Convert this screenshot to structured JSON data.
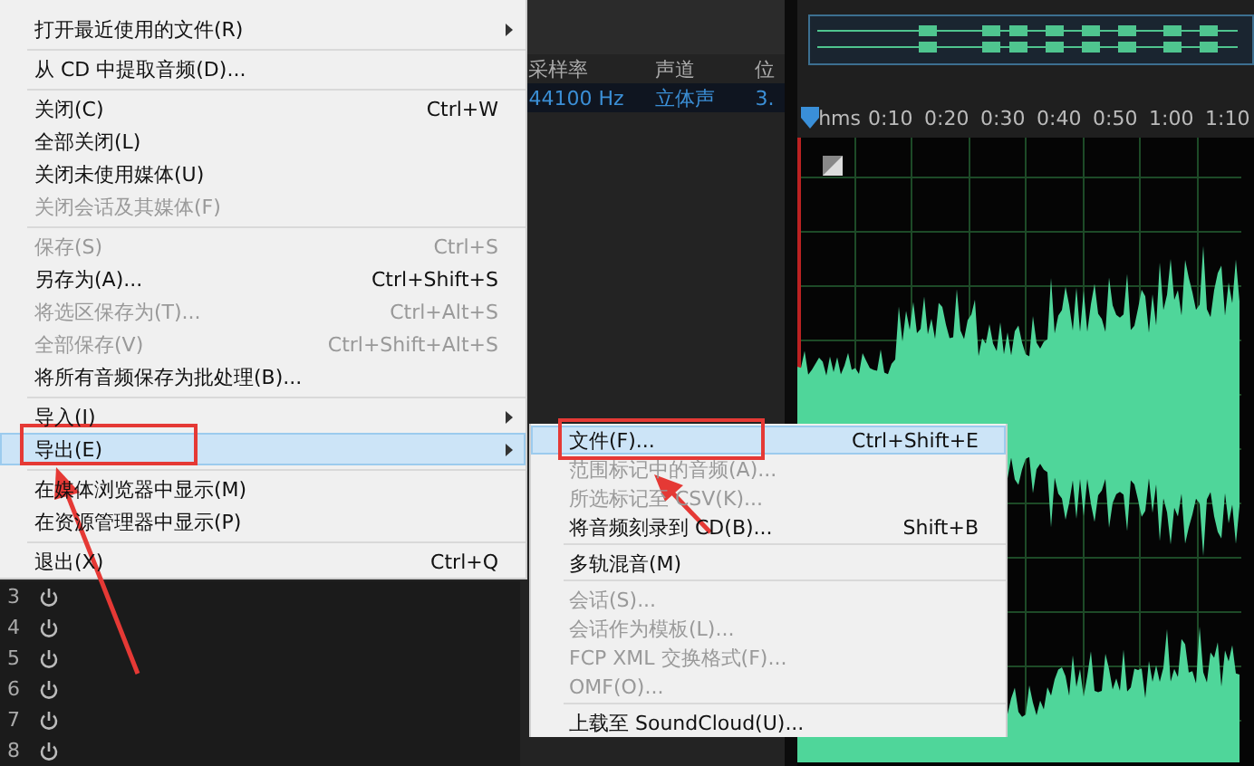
{
  "file_menu": {
    "items": [
      {
        "kind": "item",
        "label": "打开最近使用的文件(R)",
        "submenu": true,
        "disabled": false,
        "selected": false
      },
      {
        "kind": "separator"
      },
      {
        "kind": "item",
        "label": "从 CD 中提取音频(D)...",
        "submenu": false,
        "disabled": false,
        "selected": false
      },
      {
        "kind": "separator"
      },
      {
        "kind": "item",
        "label": "关闭(C)",
        "shortcut": "Ctrl+W",
        "submenu": false,
        "disabled": false,
        "selected": false
      },
      {
        "kind": "item",
        "label": "全部关闭(L)",
        "submenu": false,
        "disabled": false,
        "selected": false
      },
      {
        "kind": "item",
        "label": "关闭未使用媒体(U)",
        "submenu": false,
        "disabled": false,
        "selected": false
      },
      {
        "kind": "item",
        "label": "关闭会话及其媒体(F)",
        "submenu": false,
        "disabled": true,
        "selected": false
      },
      {
        "kind": "separator"
      },
      {
        "kind": "item",
        "label": "保存(S)",
        "shortcut": "Ctrl+S",
        "submenu": false,
        "disabled": true,
        "selected": false
      },
      {
        "kind": "item",
        "label": "另存为(A)...",
        "shortcut": "Ctrl+Shift+S",
        "submenu": false,
        "disabled": false,
        "selected": false
      },
      {
        "kind": "item",
        "label": "将选区保存为(T)...",
        "shortcut": "Ctrl+Alt+S",
        "submenu": false,
        "disabled": true,
        "selected": false
      },
      {
        "kind": "item",
        "label": "全部保存(V)",
        "shortcut": "Ctrl+Shift+Alt+S",
        "submenu": false,
        "disabled": true,
        "selected": false
      },
      {
        "kind": "item",
        "label": "将所有音频保存为批处理(B)...",
        "submenu": false,
        "disabled": false,
        "selected": false
      },
      {
        "kind": "separator"
      },
      {
        "kind": "item",
        "label": "导入(I)",
        "submenu": true,
        "disabled": false,
        "selected": false
      },
      {
        "kind": "item",
        "label": "导出(E)",
        "submenu": true,
        "disabled": false,
        "selected": true
      },
      {
        "kind": "separator"
      },
      {
        "kind": "item",
        "label": "在媒体浏览器中显示(M)",
        "submenu": false,
        "disabled": false,
        "selected": false
      },
      {
        "kind": "item",
        "label": "在资源管理器中显示(P)",
        "submenu": false,
        "disabled": false,
        "selected": false
      },
      {
        "kind": "separator"
      },
      {
        "kind": "item",
        "label": "退出(X)",
        "shortcut": "Ctrl+Q",
        "submenu": false,
        "disabled": false,
        "selected": false
      }
    ]
  },
  "export_submenu": {
    "items": [
      {
        "kind": "item",
        "label": "文件(F)...",
        "shortcut": "Ctrl+Shift+E",
        "disabled": false,
        "selected": true
      },
      {
        "kind": "item",
        "label": "范围标记中的音频(A)...",
        "disabled": true,
        "selected": false
      },
      {
        "kind": "item",
        "label": "所选标记至 CSV(K)...",
        "disabled": true,
        "selected": false
      },
      {
        "kind": "item",
        "label": "将音频刻录到 CD(B)...",
        "shortcut": "Shift+B",
        "disabled": false,
        "selected": false
      },
      {
        "kind": "separator"
      },
      {
        "kind": "item",
        "label": "多轨混音(M)",
        "disabled": false,
        "selected": false
      },
      {
        "kind": "separator"
      },
      {
        "kind": "item",
        "label": "会话(S)...",
        "disabled": true,
        "selected": false
      },
      {
        "kind": "item",
        "label": "会话作为模板(L)...",
        "disabled": true,
        "selected": false
      },
      {
        "kind": "item",
        "label": "FCP XML 交换格式(F)...",
        "disabled": true,
        "selected": false
      },
      {
        "kind": "item",
        "label": "OMF(O)...",
        "disabled": true,
        "selected": false
      },
      {
        "kind": "separator"
      },
      {
        "kind": "item",
        "label": "上载至 SoundCloud(U)...",
        "disabled": false,
        "selected": false
      }
    ]
  },
  "files_panel": {
    "columns": [
      "采样率",
      "声道",
      "位"
    ],
    "row": [
      "44100 Hz",
      "立体声",
      "3."
    ]
  },
  "track_list": [
    "3",
    "4",
    "5",
    "6",
    "7",
    "8"
  ],
  "timeline": {
    "unit": "hms",
    "labels": [
      "0:10",
      "0:20",
      "0:30",
      "0:40",
      "0:50",
      "1:00",
      "1:10"
    ]
  }
}
